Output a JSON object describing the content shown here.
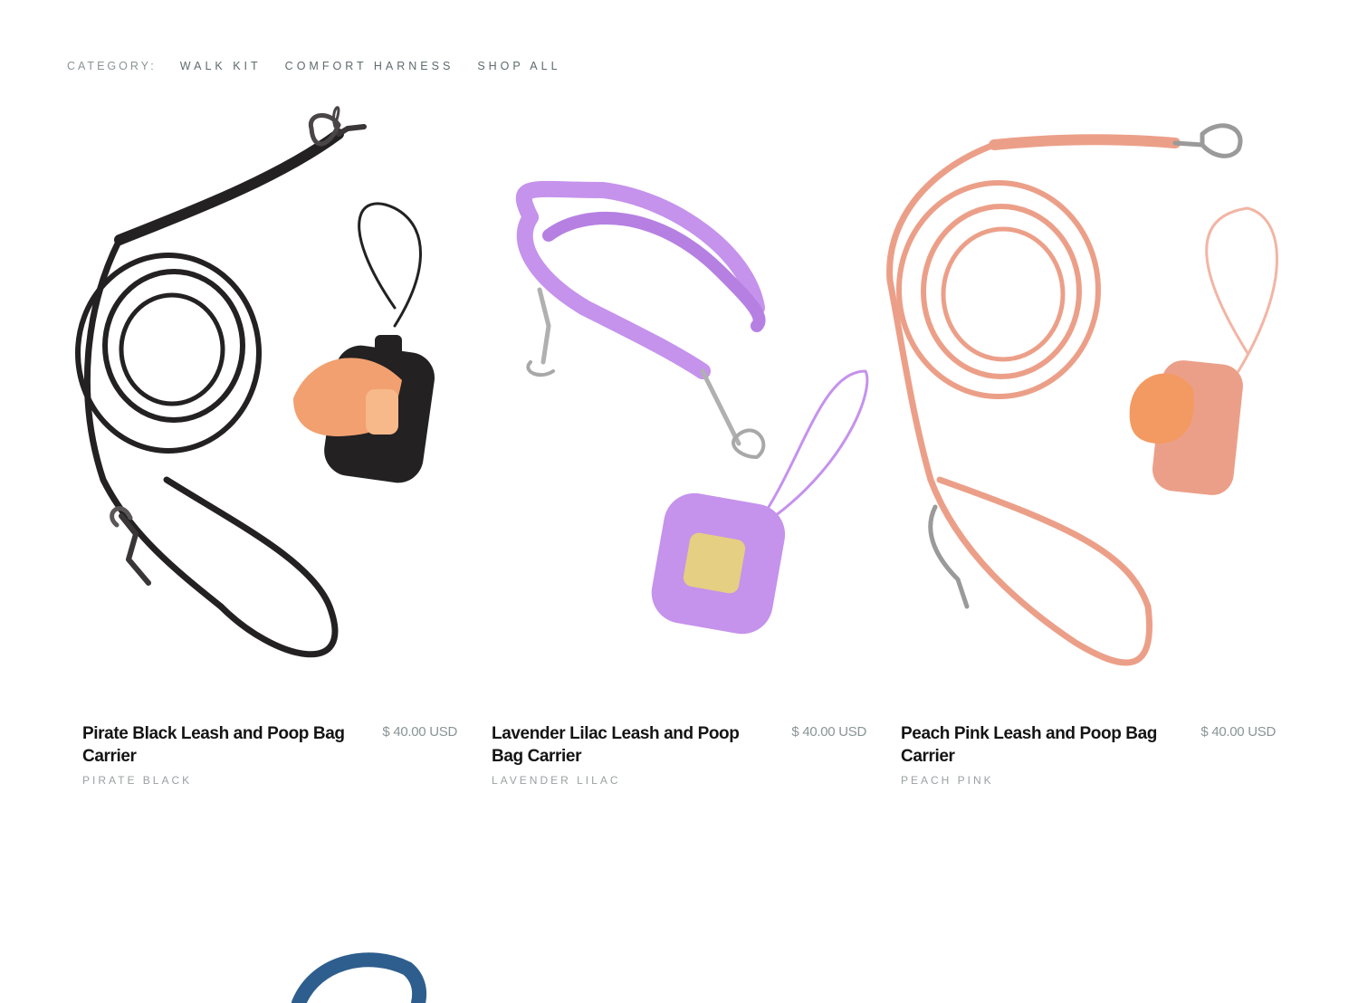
{
  "category": {
    "label": "CATEGORY:",
    "links": [
      "WALK KIT",
      "COMFORT HARNESS",
      "SHOP ALL"
    ]
  },
  "products": [
    {
      "title": "Pirate Black Leash and Poop Bag Carrier",
      "price": "$ 40.00 USD",
      "variant": "PIRATE BLACK",
      "color": "#232122",
      "bag_color": "#f2a070"
    },
    {
      "title": "Lavender Lilac Leash and Poop Bag Carrier",
      "price": "$ 40.00 USD",
      "variant": "LAVENDER LILAC",
      "color": "#c592ec",
      "bag_color": "#e4cf82"
    },
    {
      "title": "Peach Pink Leash and Poop Bag Carrier",
      "price": "$ 40.00 USD",
      "variant": "PEACH PINK",
      "color": "#ec9f88",
      "bag_color": "#f39a62"
    }
  ],
  "next_row_color": "#2e5e8e"
}
